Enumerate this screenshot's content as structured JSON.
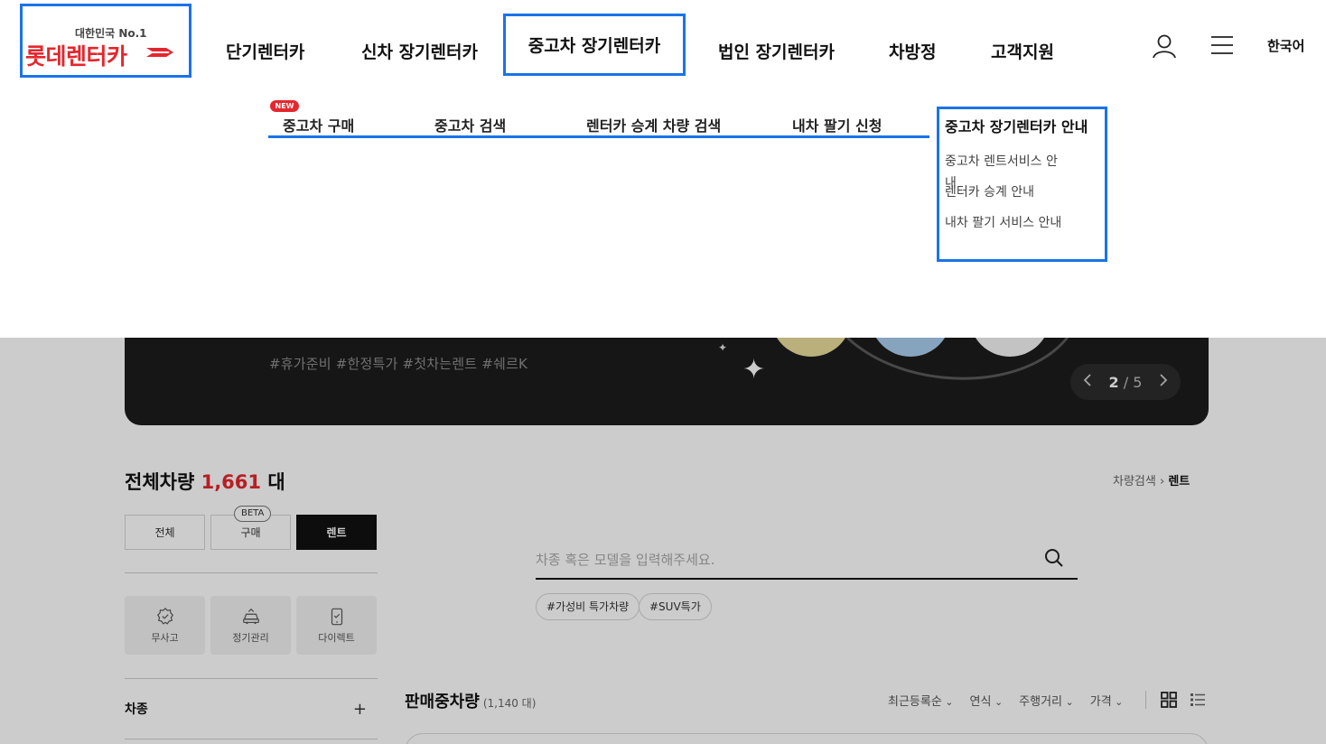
{
  "header": {
    "logo_slogan": "대한민국 No.1",
    "logo_name": "롯데렌터카",
    "menu": [
      "단기렌터카",
      "신차 장기렌터카",
      "중고차 장기렌터카",
      "법인 장기렌터카",
      "차방정",
      "고객지원"
    ],
    "language": "한국어",
    "icons": [
      "user-icon",
      "hamburger-menu-icon"
    ]
  },
  "submenu": {
    "new_badge": "NEW",
    "items": [
      "중고차 구매",
      "중고차 검색",
      "렌터카 승계 차량 검색",
      "내차 팔기 신청"
    ],
    "guide": {
      "title": "중고차 장기렌터카 안내",
      "links": [
        "중고차 렌트서비스 안내",
        "렌터카 승계 안내",
        "내차 팔기 서비스 안내"
      ]
    }
  },
  "banner": {
    "hashtags": "#휴가준비  #한정특가  #첫차는렌트  #쉐르K",
    "pager": {
      "current": "2",
      "separator": "/",
      "total": "5"
    }
  },
  "vehicles": {
    "title_prefix": "전체차량",
    "count": "1,661",
    "unit": "대"
  },
  "breadcrumb": {
    "parent": "차량검색",
    "current": "렌트"
  },
  "segments": [
    {
      "label": "전체",
      "active": false
    },
    {
      "label": "구매",
      "active": false,
      "badge": "BETA"
    },
    {
      "label": "렌트",
      "active": true
    }
  ],
  "features": [
    "무사고",
    "정기관리",
    "다이렉트"
  ],
  "category": {
    "label": "차종",
    "toggle": "+"
  },
  "search": {
    "placeholder": "차종 혹은 모델을 입력해주세요.",
    "value": ""
  },
  "tags": [
    "#가성비 특가차량",
    "#SUV특가"
  ],
  "listing": {
    "title": "판매중차량",
    "sub": "(1,140 대)",
    "sorts": [
      "최근등록순",
      "연식",
      "주행거리",
      "가격"
    ]
  },
  "colors": {
    "accent_red": "#e5262d",
    "highlight_blue": "#1a73e8"
  }
}
